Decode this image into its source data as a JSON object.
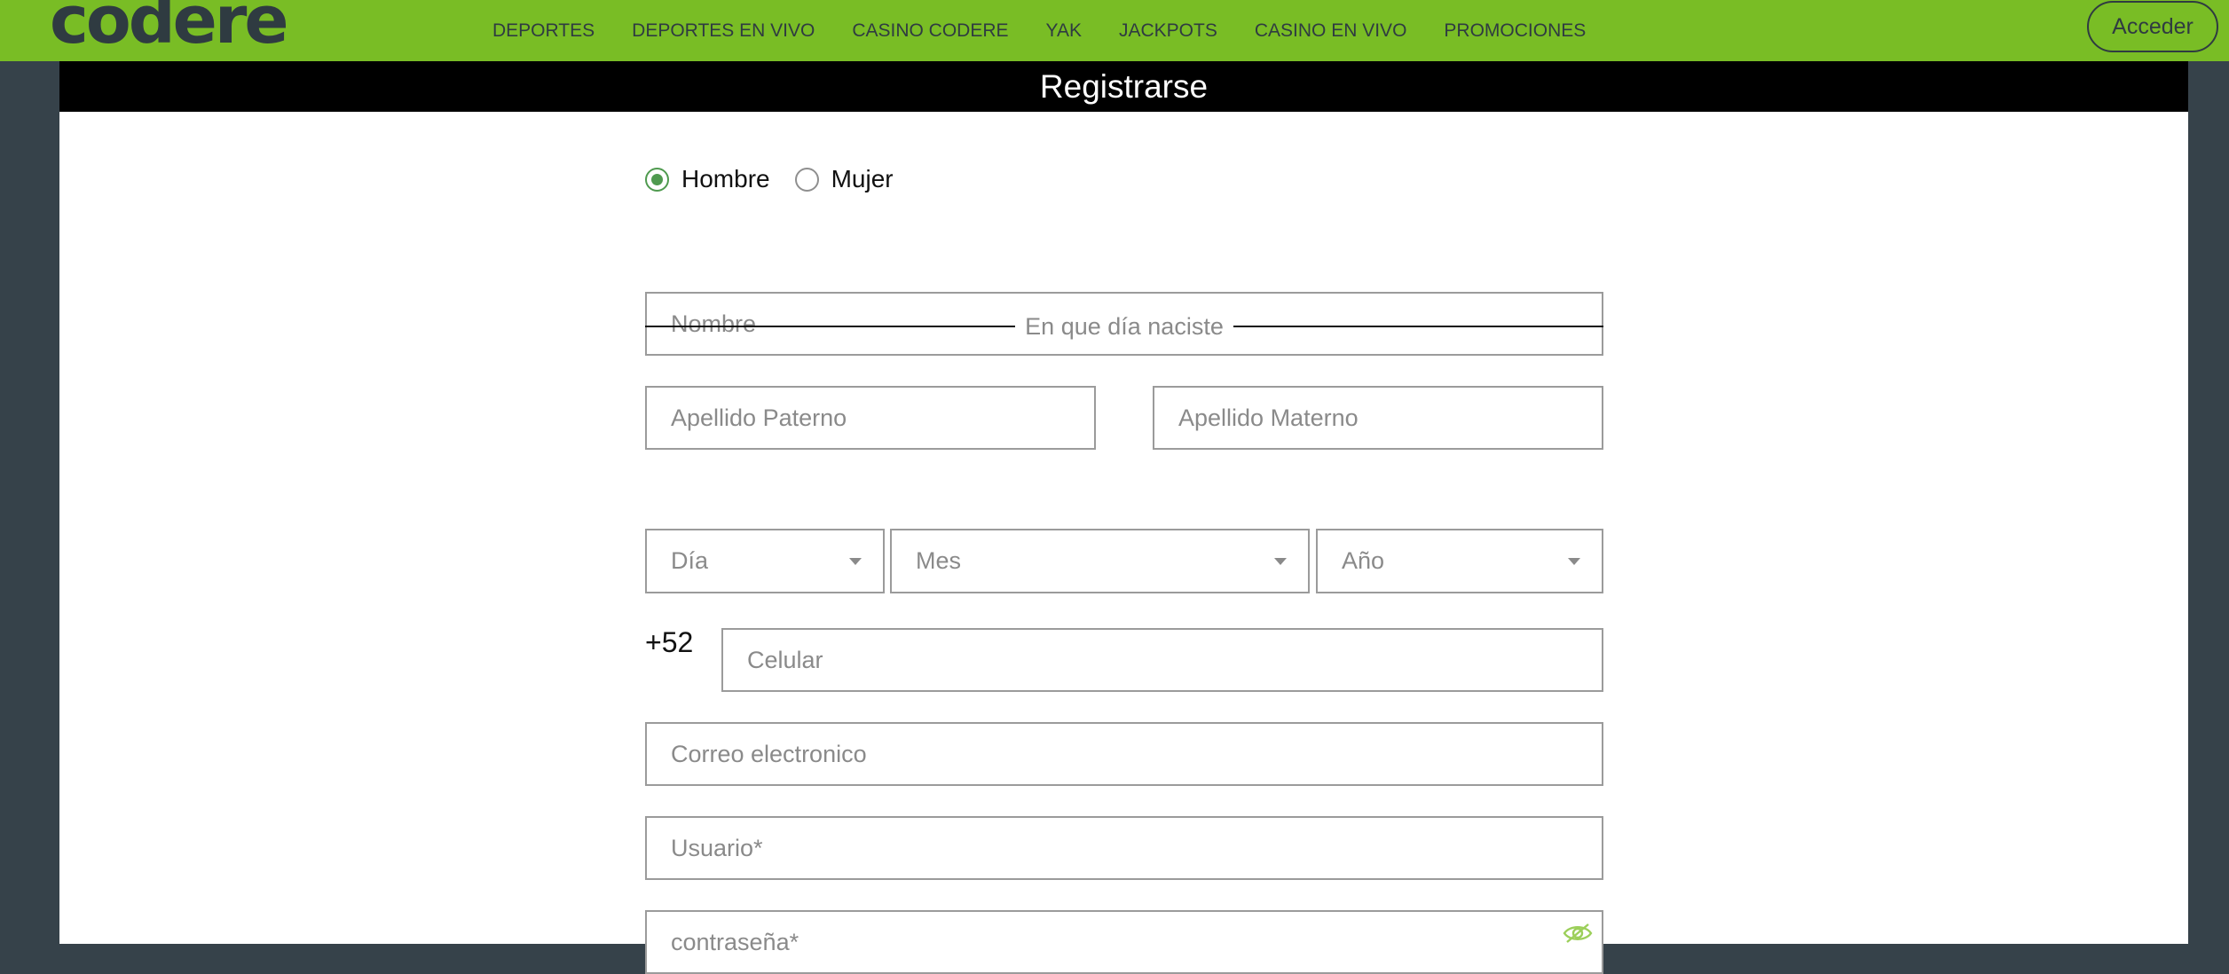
{
  "header": {
    "logo": "codere",
    "nav": [
      "DEPORTES",
      "DEPORTES EN VIVO",
      "CASINO CODERE",
      "YAK",
      "JACKPOTS",
      "CASINO EN VIVO",
      "PROMOCIONES"
    ],
    "login_label": "Acceder"
  },
  "panel": {
    "title": "Registrarse"
  },
  "form": {
    "gender": {
      "options": [
        "Hombre",
        "Mujer"
      ],
      "selected": "Hombre"
    },
    "nombre_placeholder": "Nombre",
    "apellido_paterno_placeholder": "Apellido Paterno",
    "apellido_materno_placeholder": "Apellido Materno",
    "birth_divider": "En que día naciste",
    "dia_label": "Día",
    "mes_label": "Mes",
    "ano_label": "Año",
    "phone_prefix": "+52",
    "celular_placeholder": "Celular",
    "correo_placeholder": "Correo electronico",
    "usuario_placeholder": "Usuario*",
    "password_placeholder": "contraseña*"
  },
  "colors": {
    "brand_green": "#79bd25",
    "dark_slate": "#36424a",
    "radio_green": "#4f9a4f",
    "eye_icon": "#9ccf5a"
  },
  "icons": {
    "password_toggle": "eye-slash-icon"
  }
}
